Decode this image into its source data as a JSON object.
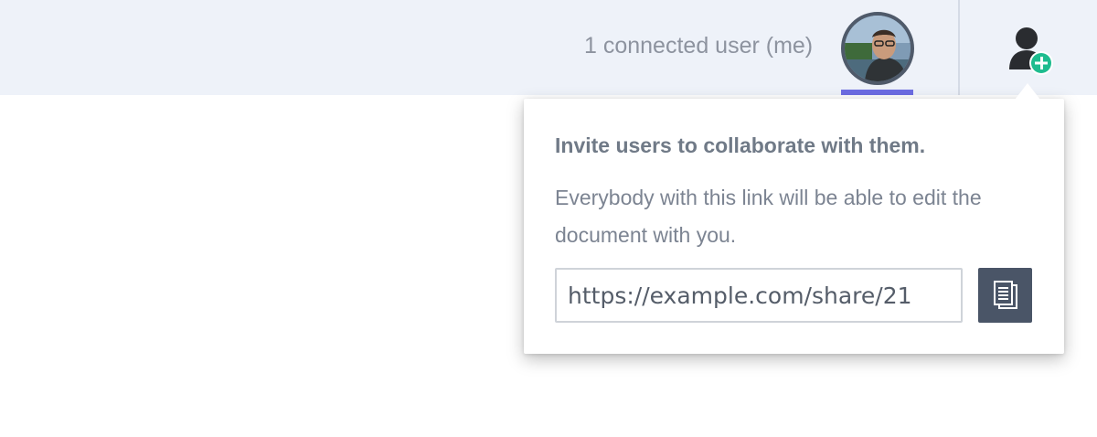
{
  "header": {
    "connected_users_text": "1 connected user (me)",
    "avatar_icon": "user-avatar-photo",
    "invite_icon": "add-user-icon",
    "underline_color": "#6d6de3",
    "invite_badge_color": "#1ebc8f"
  },
  "share_popover": {
    "title": "Invite users to collaborate with them.",
    "description": "Everybody with this link will be able to edit the document with you.",
    "link_value": "https://example.com/share/21",
    "copy_icon": "copy-document-icon"
  }
}
